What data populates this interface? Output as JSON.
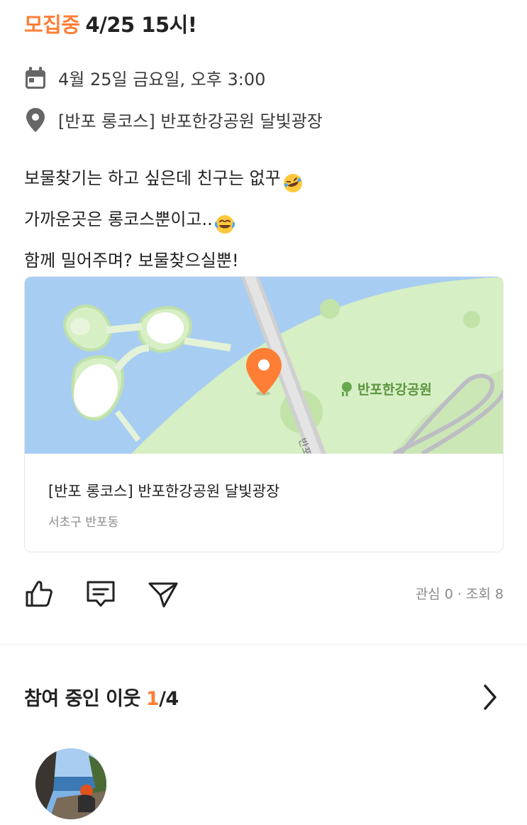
{
  "post": {
    "status": "모집중",
    "when_title": "4/25 15시!",
    "date_text": "4월 25일 금요일, 오후 3:00",
    "place_text": "[반포 롱코스] 반포한강공원 달빛광장",
    "description": [
      "보물찾기는 하고 싶은데 친구는 없꾸",
      "가까운곳은 롱코스뿐이고..",
      "함께 밀어주며? 보물찾으실뿐!"
    ]
  },
  "map": {
    "park_label": "반포한강공원",
    "road_label": "반포",
    "place_name": "[반포 롱코스] 반포한강공원 달빛광장",
    "address": "서초구 반포동"
  },
  "actions": {
    "stats": "관심 0 · 조회 8"
  },
  "participants": {
    "label": "참여 중인 이웃",
    "count": "1",
    "total": "/4"
  },
  "icons": {
    "date": "calendar-icon",
    "place": "location-pin-icon",
    "like": "thumbs-up-icon",
    "comment": "comment-icon",
    "share": "send-icon",
    "more": "chevron-right-icon"
  },
  "colors": {
    "accent": "#ff7e36",
    "text": "#222222",
    "muted": "#8b8b8b",
    "water": "#a8cdf3",
    "park": "#d6efc4"
  }
}
